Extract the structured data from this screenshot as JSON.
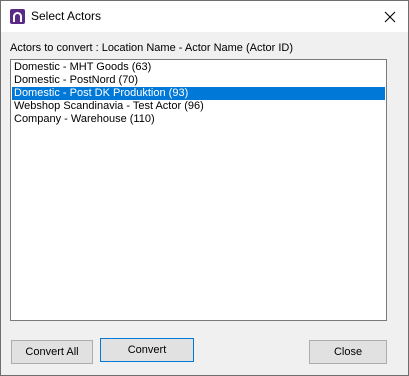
{
  "window": {
    "title": "Select Actors"
  },
  "header": {
    "label": "Actors to convert : Location Name - Actor Name (Actor ID)"
  },
  "actors": [
    {
      "label": "Domestic - MHT Goods (63)",
      "selected": false
    },
    {
      "label": "Domestic - PostNord (70)",
      "selected": false
    },
    {
      "label": "Domestic - Post DK Produktion (93)",
      "selected": true
    },
    {
      "label": "Webshop Scandinavia - Test Actor (96)",
      "selected": false
    },
    {
      "label": "Company - Warehouse (110)",
      "selected": false
    }
  ],
  "buttons": {
    "convert_all": "Convert All",
    "convert": "Convert",
    "close": "Close"
  },
  "colors": {
    "selection": "#0078d7",
    "app_icon": "#5b2a86"
  },
  "icons": {
    "app": "app-logo-icon",
    "close": "close-icon"
  }
}
